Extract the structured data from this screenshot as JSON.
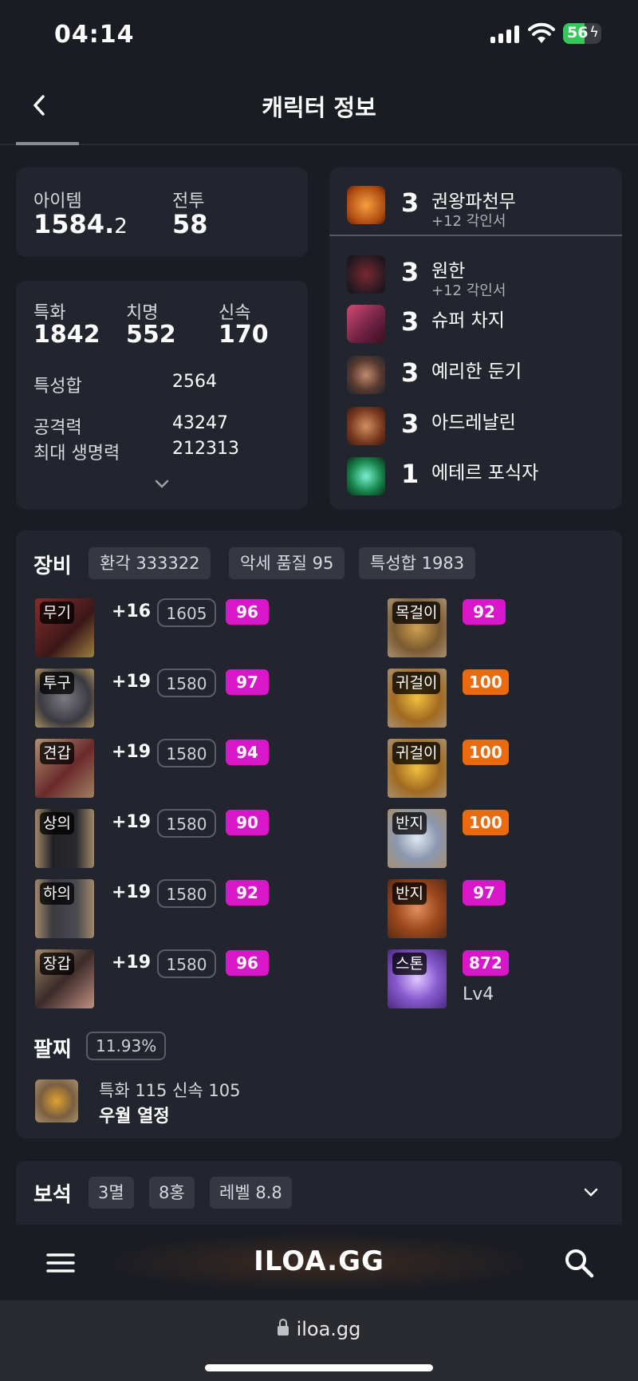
{
  "status_bar": {
    "time": "04:14",
    "battery": "56",
    "battery_level": 0.56
  },
  "header": {
    "title": "캐릭터 정보"
  },
  "item_combat": {
    "item_label": "아이템",
    "item_value_main": "1584.",
    "item_value_decimal": "2",
    "combat_label": "전투",
    "combat_value": "58"
  },
  "stats": {
    "crit_spec_label": "특화",
    "crit_spec_value": "1842",
    "crit_label": "치명",
    "crit_value": "552",
    "swift_label": "신속",
    "swift_value": "170",
    "sum_label": "특성합",
    "sum_value": "2564",
    "atk_label": "공격력",
    "atk_value": "43247",
    "hp_label": "최대 생명력",
    "hp_value": "212313"
  },
  "engravings": [
    {
      "level": "3",
      "name": "권왕파천무",
      "sub": "+12 각인서",
      "icon": "flame-fist-icon"
    },
    {
      "level": "3",
      "name": "원한",
      "sub": "+12 각인서",
      "icon": "demon-icon"
    },
    {
      "level": "3",
      "name": "슈퍼 차지",
      "sub": "",
      "icon": "charge-icon"
    },
    {
      "level": "3",
      "name": "예리한 둔기",
      "sub": "",
      "icon": "mace-icon"
    },
    {
      "level": "3",
      "name": "아드레날린",
      "sub": "",
      "icon": "adrenaline-icon"
    },
    {
      "level": "1",
      "name": "에테르 포식자",
      "sub": "",
      "icon": "ether-icon"
    }
  ],
  "equipment": {
    "title": "장비",
    "chips": [
      "환각 333322",
      "악세 품질 95",
      "특성합 1983"
    ],
    "gear": [
      {
        "slot": "무기",
        "plus": "+16",
        "level": "1605",
        "quality": "96"
      },
      {
        "slot": "투구",
        "plus": "+19",
        "level": "1580",
        "quality": "97"
      },
      {
        "slot": "견갑",
        "plus": "+19",
        "level": "1580",
        "quality": "94"
      },
      {
        "slot": "상의",
        "plus": "+19",
        "level": "1580",
        "quality": "90"
      },
      {
        "slot": "하의",
        "plus": "+19",
        "level": "1580",
        "quality": "92"
      },
      {
        "slot": "장갑",
        "plus": "+19",
        "level": "1580",
        "quality": "96"
      }
    ],
    "accessories": [
      {
        "slot": "목걸이",
        "quality": "92",
        "color": "#d916c9"
      },
      {
        "slot": "귀걸이",
        "quality": "100",
        "color": "#ea6a10"
      },
      {
        "slot": "귀걸이",
        "quality": "100",
        "color": "#ea6a10"
      },
      {
        "slot": "반지",
        "quality": "100",
        "color": "#ea6a10"
      },
      {
        "slot": "반지",
        "quality": "97",
        "color": "#d916c9"
      },
      {
        "slot": "스톤",
        "quality": "872",
        "color": "#d916c9",
        "sub": "Lv4"
      }
    ],
    "bracelet": {
      "title": "팔찌",
      "percent": "11.93%",
      "stats": "특화 115  신속 105",
      "effects": "우월  열정"
    }
  },
  "gems": {
    "title": "보석",
    "chips": [
      "3멸",
      "8홍",
      "레벨 8.8"
    ]
  },
  "bottom_nav": {
    "logo": "ILOA.GG"
  },
  "url_bar": {
    "url": "iloa.gg"
  },
  "colors": {
    "quality_purple": "#d916c9",
    "quality_orange": "#ea6a10",
    "card_bg": "#22252d",
    "page_bg": "#1a1c23"
  }
}
